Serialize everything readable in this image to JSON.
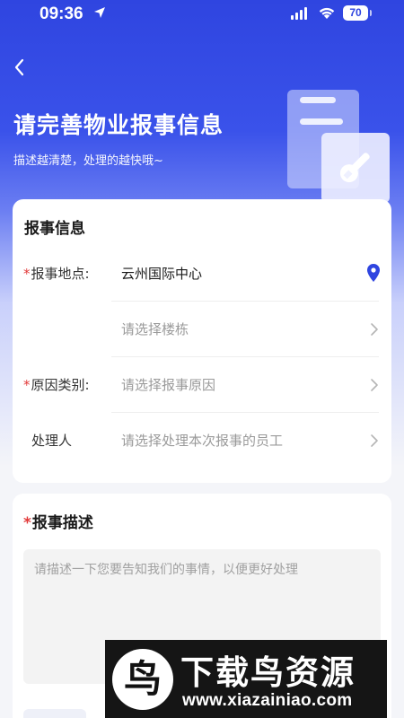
{
  "status_bar": {
    "time": "09:36",
    "battery": "70"
  },
  "header": {
    "back_icon": "chevron-left-icon",
    "title": "请完善物业报事信息",
    "subtitle": "描述越清楚，处理的越快哦~",
    "illustration_icon": "document-wrench-icon"
  },
  "report_info": {
    "title": "报事信息",
    "rows": [
      {
        "label": "报事地点:",
        "required": true,
        "value": "云州国际中心",
        "placeholder": "",
        "icon": "location-pin-icon"
      },
      {
        "label": "",
        "required": false,
        "value": "",
        "placeholder": "请选择楼栋",
        "icon": "chevron-right-icon"
      },
      {
        "label": "原因类别:",
        "required": true,
        "value": "",
        "placeholder": "请选择报事原因",
        "icon": "chevron-right-icon"
      },
      {
        "label": "处理人",
        "required": false,
        "value": "",
        "placeholder": "请选择处理本次报事的员工",
        "icon": "chevron-right-icon"
      }
    ]
  },
  "description": {
    "title": "报事描述",
    "required": true,
    "placeholder": "请描述一下您要告知我们的事情，以便更好处理",
    "value": ""
  },
  "watermark": {
    "logo_char": "鸟",
    "title": "下载鸟资源",
    "url": "www.xiazainiao.com"
  },
  "colors": {
    "brand_blue": "#2f45e0",
    "required_red": "#e23b3b",
    "pin_blue": "#2f45e0"
  }
}
